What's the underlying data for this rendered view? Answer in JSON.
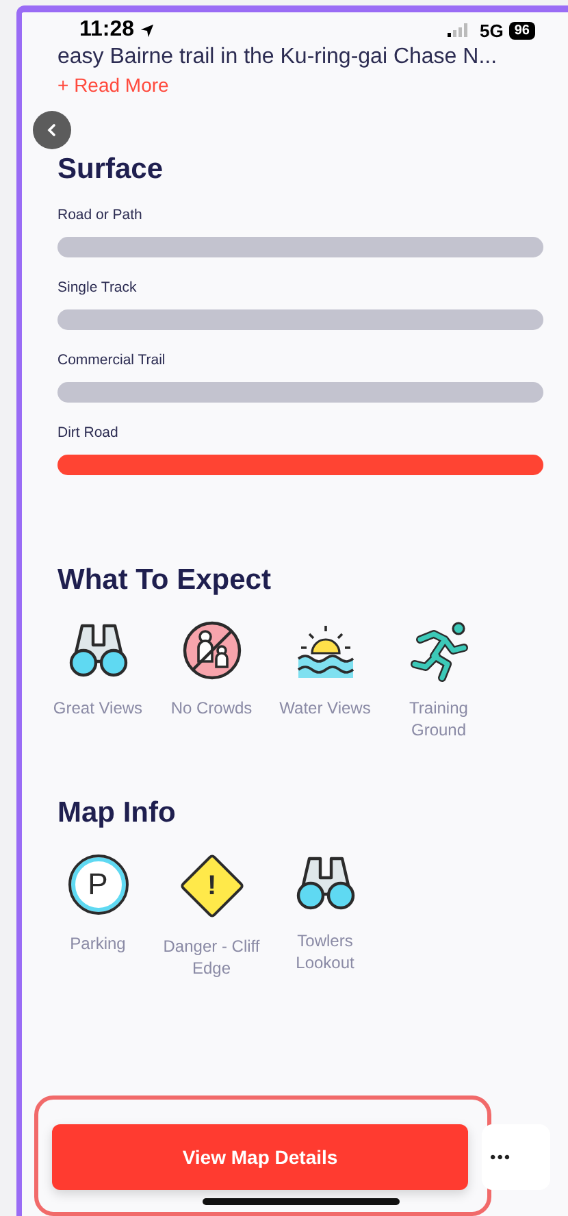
{
  "status_bar": {
    "time": "11:28",
    "network": "5G",
    "battery": "96"
  },
  "description": {
    "lines": [
      "easy Bairne trail in the Ku-ring-gai Chase N..."
    ],
    "read_more": "+ Read More"
  },
  "surface": {
    "title": "Surface",
    "items": [
      {
        "label": "Road or Path",
        "selected": false
      },
      {
        "label": "Single Track",
        "selected": false
      },
      {
        "label": "Commercial Trail",
        "selected": false
      },
      {
        "label": "Dirt Road",
        "selected": true
      }
    ]
  },
  "what_to_expect": {
    "title": "What To Expect",
    "items": [
      {
        "kind": "binoculars",
        "label": "Great Views"
      },
      {
        "kind": "no-crowds",
        "label": "No Crowds"
      },
      {
        "kind": "water",
        "label": "Water Views"
      },
      {
        "kind": "runner",
        "label": "Training Ground"
      }
    ]
  },
  "map_info": {
    "title": "Map Info",
    "items": [
      {
        "kind": "parking",
        "label": "Parking",
        "glyph": "P"
      },
      {
        "kind": "danger",
        "label": "Danger - Cliff Edge",
        "glyph": "!"
      },
      {
        "kind": "binoculars",
        "label": "Towlers Lookout"
      }
    ]
  },
  "bottom_bar": {
    "button": "View Map Details",
    "more": "•••"
  }
}
